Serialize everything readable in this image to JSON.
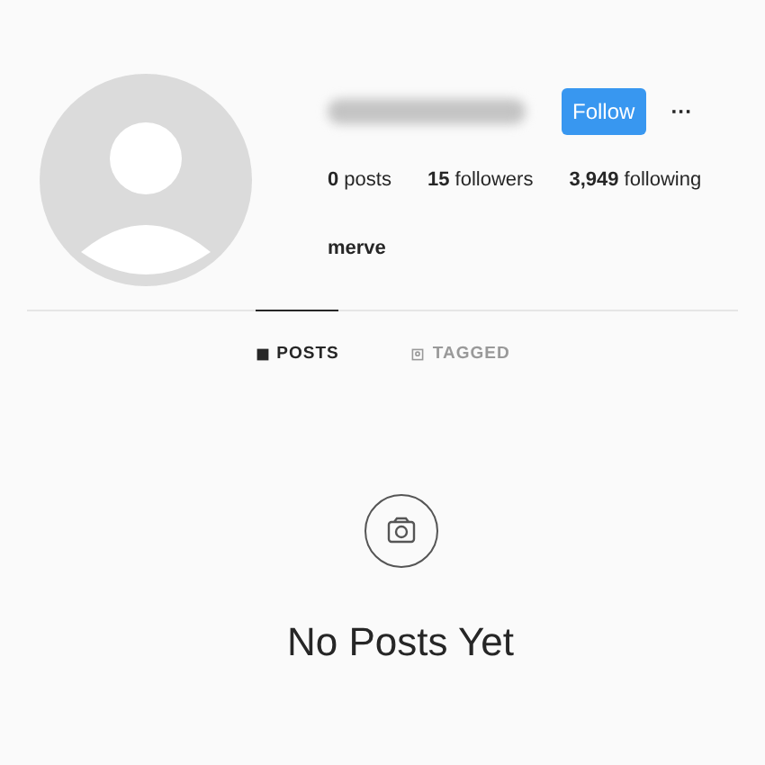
{
  "profile": {
    "follow_button": "Follow",
    "more": "···",
    "stats": [
      "**0** posts",
      "**15** followers",
      "**3,949** following"
    ],
    "name": "merve"
  },
  "tabs": [
    {
      "label": "POSTS",
      "selected": true
    },
    {
      "label": "TAGGED",
      "selected": false
    }
  ],
  "empty_state": {
    "message": "No Posts Yet"
  }
}
